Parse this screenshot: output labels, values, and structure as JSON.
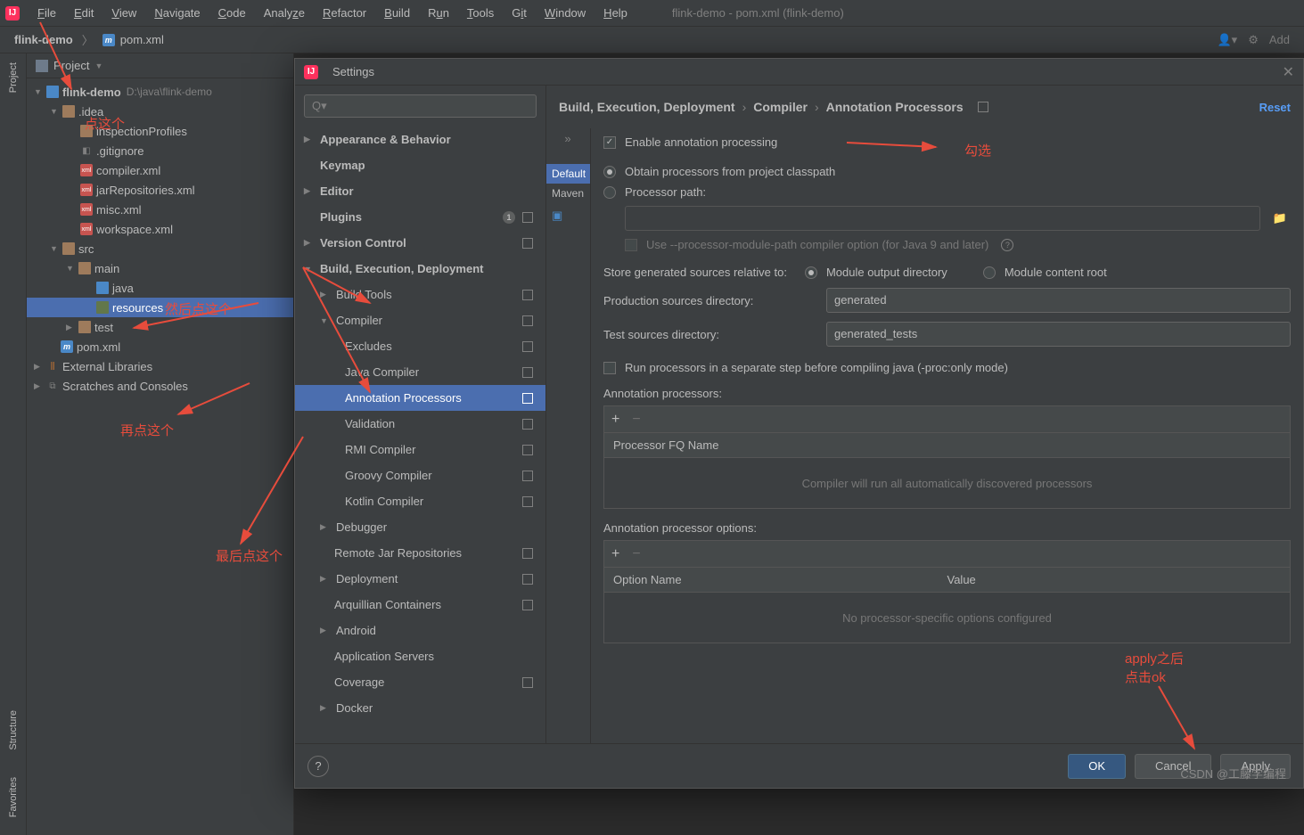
{
  "menu": [
    "File",
    "Edit",
    "View",
    "Navigate",
    "Code",
    "Analyze",
    "Refactor",
    "Build",
    "Run",
    "Tools",
    "Git",
    "Window",
    "Help"
  ],
  "windowTitle": "flink-demo - pom.xml (flink-demo)",
  "breadcrumb": {
    "project": "flink-demo",
    "file": "pom.xml"
  },
  "topRight": "Add",
  "gutter": {
    "project": "Project",
    "structure": "Structure",
    "favorites": "Favorites"
  },
  "projectHeader": "Project",
  "tree": {
    "root": "flink-demo",
    "rootPath": "D:\\java\\flink-demo",
    "idea": ".idea",
    "ideaItems": [
      "inspectionProfiles",
      ".gitignore",
      "compiler.xml",
      "jarRepositories.xml",
      "misc.xml",
      "workspace.xml"
    ],
    "src": "src",
    "main": "main",
    "java": "java",
    "resources": "resources",
    "test": "test",
    "pom": "pom.xml",
    "extLib": "External Libraries",
    "scratches": "Scratches and Consoles"
  },
  "dialog": {
    "title": "Settings",
    "searchPlaceholder": "",
    "reset": "Reset",
    "bcSeg1": "Build, Execution, Deployment",
    "bcSeg2": "Compiler",
    "bcSeg3": "Annotation Processors",
    "cats": {
      "appearance": "Appearance & Behavior",
      "keymap": "Keymap",
      "editor": "Editor",
      "plugins": "Plugins",
      "pluginsCount": "1",
      "vcs": "Version Control",
      "bed": "Build, Execution, Deployment",
      "buildTools": "Build Tools",
      "compiler": "Compiler",
      "excludes": "Excludes",
      "javaCompiler": "Java Compiler",
      "annotation": "Annotation Processors",
      "validation": "Validation",
      "rmi": "RMI Compiler",
      "groovy": "Groovy Compiler",
      "kotlin": "Kotlin Compiler",
      "debugger": "Debugger",
      "remoteJar": "Remote Jar Repositories",
      "deployment": "Deployment",
      "arquillian": "Arquillian Containers",
      "android": "Android",
      "appServers": "Application Servers",
      "coverage": "Coverage",
      "docker": "Docker"
    },
    "profiles": {
      "default": "Default",
      "maven": "Maven"
    },
    "form": {
      "enable": "Enable annotation processing",
      "obtain": "Obtain processors from project classpath",
      "procPath": "Processor path:",
      "useModule": "Use --processor-module-path compiler option (for Java 9 and later)",
      "storeRel": "Store generated sources relative to:",
      "modOut": "Module output directory",
      "modContent": "Module content root",
      "prodDir": "Production sources directory:",
      "prodVal": "generated",
      "testDir": "Test sources directory:",
      "testVal": "generated_tests",
      "runSep": "Run processors in a separate step before compiling java (-proc:only mode)",
      "annProc": "Annotation processors:",
      "fqName": "Processor FQ Name",
      "emptyProc": "Compiler will run all automatically discovered processors",
      "annOpt": "Annotation processor options:",
      "optName": "Option Name",
      "value": "Value",
      "emptyOpt": "No processor-specific options configured"
    },
    "buttons": {
      "ok": "OK",
      "cancel": "Cancel",
      "apply": "Apply"
    }
  },
  "annotations": {
    "a1": "点这个",
    "a2": "然后点这个",
    "a3": "再点这个",
    "a4": "最后点这个",
    "a5": "勾选",
    "a6": "apply之后\n点击ok"
  },
  "watermark": "CSDN @工藤学编程"
}
